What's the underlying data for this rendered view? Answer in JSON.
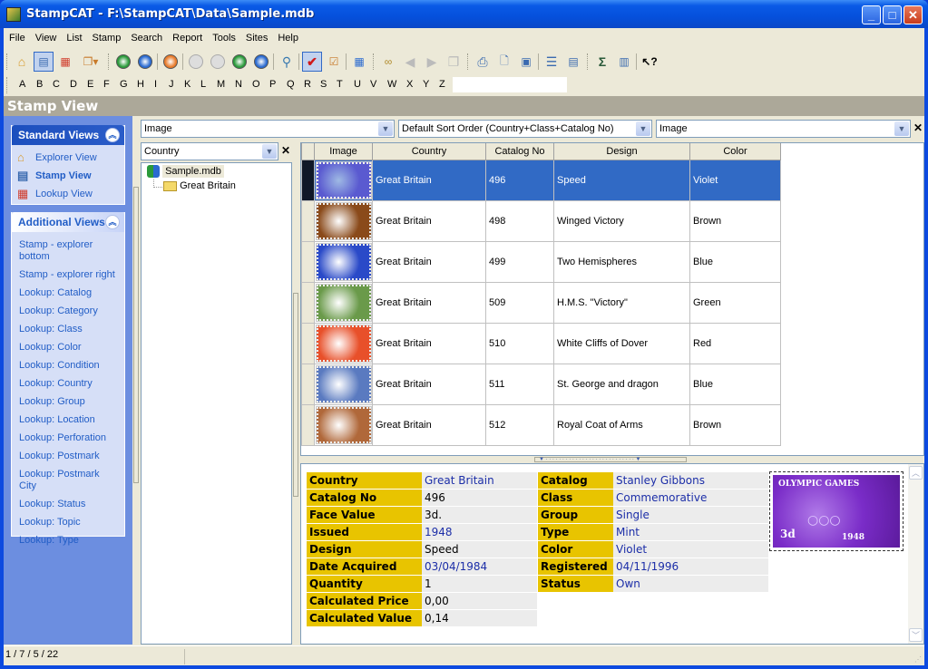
{
  "window": {
    "title": "StampCAT - F:\\StampCAT\\Data\\Sample.mdb",
    "minimize": "_",
    "maximize": "□",
    "close": "✕"
  },
  "menu": [
    "File",
    "View",
    "List",
    "Stamp",
    "Search",
    "Report",
    "Tools",
    "Sites",
    "Help"
  ],
  "toolbar": {
    "icons": [
      "explorer-view-icon",
      "stamp-view-icon",
      "lookup-view-icon",
      "copy-dropdown-icon",
      "add-icon",
      "edit-icon",
      "refresh-icon",
      "first-record-icon",
      "previous-record-icon",
      "next-record-icon",
      "last-record-icon",
      "find-icon",
      "checkmark-icon",
      "checklist-icon",
      "grid-layout-icon",
      "binoculars-icon",
      "back-arrow-icon",
      "forward-arrow-icon",
      "windows-icon",
      "print-icon",
      "print-preview-icon",
      "export-icon",
      "report-icon",
      "form-icon",
      "sum-icon",
      "chart-icon",
      "help-pointer-icon"
    ]
  },
  "alphabet": [
    "A",
    "B",
    "C",
    "D",
    "E",
    "F",
    "G",
    "H",
    "I",
    "J",
    "K",
    "L",
    "M",
    "N",
    "O",
    "P",
    "Q",
    "R",
    "S",
    "T",
    "U",
    "V",
    "W",
    "X",
    "Y",
    "Z"
  ],
  "alpha_search_value": "",
  "view_title": "Stamp View",
  "sidebar": {
    "standard": {
      "title": "Standard Views",
      "items": [
        {
          "label": "Explorer View",
          "icon": "house-icon"
        },
        {
          "label": "Stamp View",
          "icon": "stamp-card-icon",
          "active": true
        },
        {
          "label": "Lookup View",
          "icon": "table-icon"
        }
      ]
    },
    "additional": {
      "title": "Additional Views",
      "items": [
        "Stamp - explorer bottom",
        "Stamp - explorer right",
        "Lookup: Catalog",
        "Lookup: Category",
        "Lookup: Class",
        "Lookup: Color",
        "Lookup: Condition",
        "Lookup: Country",
        "Lookup: Group",
        "Lookup: Location",
        "Lookup: Perforation",
        "Lookup: Postmark",
        "Lookup: Postmark City",
        "Lookup: Status",
        "Lookup: Topic",
        "Lookup: Type"
      ]
    }
  },
  "filters": {
    "left_combo": "Image",
    "sort_combo": "Default Sort Order (Country+Class+Catalog No)",
    "right_combo": "Image",
    "tree_combo": "Country"
  },
  "tree": {
    "root": "Sample.mdb",
    "children": [
      "Great Britain"
    ]
  },
  "grid": {
    "columns": [
      "Image",
      "Country",
      "Catalog No",
      "Design",
      "Color"
    ],
    "rows": [
      {
        "country": "Great Britain",
        "catalog_no": "496",
        "design": "Speed",
        "color": "Violet",
        "stamp_color": "#5a5ad0",
        "selected": true
      },
      {
        "country": "Great Britain",
        "catalog_no": "498",
        "design": "Winged Victory",
        "color": "Brown",
        "stamp_color": "#8a4a1a"
      },
      {
        "country": "Great Britain",
        "catalog_no": "499",
        "design": "Two Hemispheres",
        "color": "Blue",
        "stamp_color": "#2a4ac8"
      },
      {
        "country": "Great Britain",
        "catalog_no": "509",
        "design": "H.M.S. \"Victory\"",
        "color": "Green",
        "stamp_color": "#6a9a4a"
      },
      {
        "country": "Great Britain",
        "catalog_no": "510",
        "design": "White Cliffs of Dover",
        "color": "Red",
        "stamp_color": "#e8502a"
      },
      {
        "country": "Great Britain",
        "catalog_no": "511",
        "design": "St. George and dragon",
        "color": "Blue",
        "stamp_color": "#5a7ac0"
      },
      {
        "country": "Great Britain",
        "catalog_no": "512",
        "design": "Royal Coat of Arms",
        "color": "Brown",
        "stamp_color": "#b0683a"
      }
    ]
  },
  "detail": {
    "left": [
      {
        "key": "Country",
        "value": "Great Britain",
        "link": true
      },
      {
        "key": "Catalog No",
        "value": "496"
      },
      {
        "key": "Face Value",
        "value": "3d."
      },
      {
        "key": "Issued",
        "value": "1948",
        "link": true
      },
      {
        "key": "Design",
        "value": "Speed"
      },
      {
        "key": "Date Acquired",
        "value": "03/04/1984",
        "link": true
      },
      {
        "key": "Quantity",
        "value": "1"
      },
      {
        "key": "Calculated Price",
        "value": "0,00"
      },
      {
        "key": "Calculated Value",
        "value": "0,14"
      }
    ],
    "right": [
      {
        "key": "Catalog",
        "value": "Stanley Gibbons",
        "link": true
      },
      {
        "key": "Class",
        "value": "Commemorative",
        "link": true
      },
      {
        "key": "Group",
        "value": "Single",
        "link": true
      },
      {
        "key": "Type",
        "value": "Mint",
        "link": true
      },
      {
        "key": "Color",
        "value": "Violet",
        "link": true
      },
      {
        "key": "Registered",
        "value": "04/11/1996",
        "link": true
      },
      {
        "key": "Status",
        "value": "Own",
        "link": true
      }
    ],
    "stamp_image": {
      "top_text": "OLYMPIC GAMES",
      "value_text": "3d",
      "year_text": "1948"
    }
  },
  "status": {
    "counts": "1 / 7 / 5 / 22"
  },
  "colors": {
    "selection": "#316ac5",
    "detail_key_bg": "#e8c400",
    "link": "#1c2ea8",
    "sidebar_bg": "#6c8ee0"
  }
}
